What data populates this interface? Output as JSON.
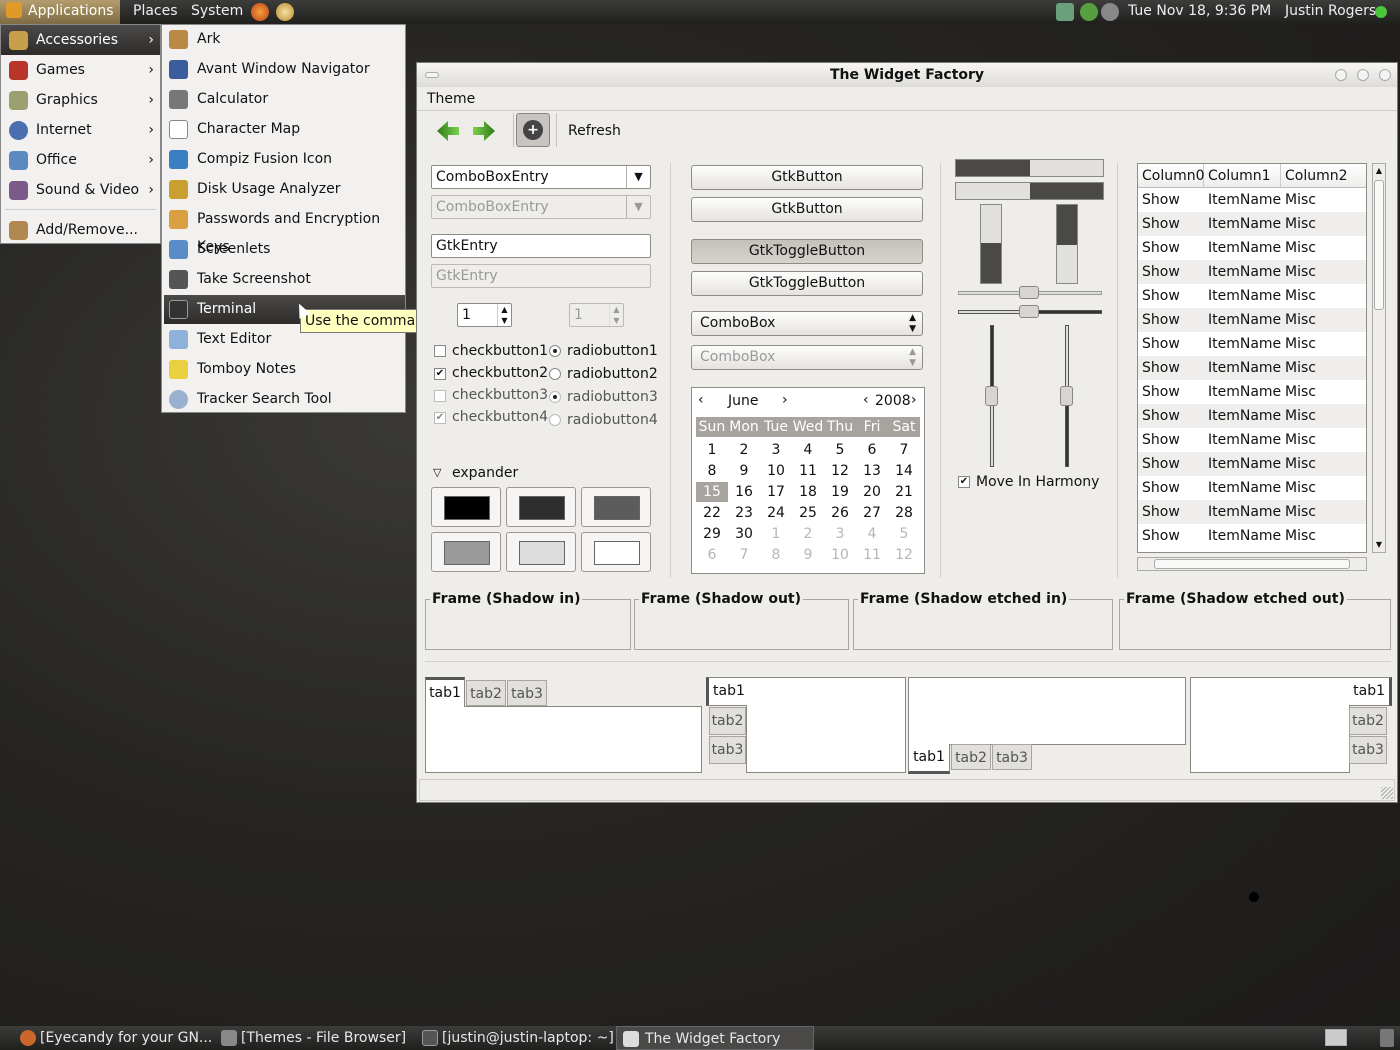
{
  "top_panel": {
    "applications": "Applications",
    "places": "Places",
    "system": "System",
    "clock": "Tue Nov 18,  9:36 PM",
    "user": "Justin Rogers"
  },
  "main_menu": {
    "items": [
      {
        "label": "Accessories",
        "icon": "accessories-icon"
      },
      {
        "label": "Games",
        "icon": "games-icon"
      },
      {
        "label": "Graphics",
        "icon": "graphics-icon"
      },
      {
        "label": "Internet",
        "icon": "internet-icon"
      },
      {
        "label": "Office",
        "icon": "office-icon"
      },
      {
        "label": "Sound & Video",
        "icon": "sound-video-icon"
      },
      {
        "label": "Add/Remove...",
        "icon": "add-remove-icon"
      }
    ]
  },
  "sub_menu": {
    "items": [
      {
        "label": "Ark"
      },
      {
        "label": "Avant Window Navigator"
      },
      {
        "label": "Calculator"
      },
      {
        "label": "Character Map"
      },
      {
        "label": "Compiz Fusion Icon"
      },
      {
        "label": "Disk Usage Analyzer"
      },
      {
        "label": "Passwords and Encryption Keys"
      },
      {
        "label": "Screenlets"
      },
      {
        "label": "Take Screenshot"
      },
      {
        "label": "Terminal"
      },
      {
        "label": "Text Editor"
      },
      {
        "label": "Tomboy Notes"
      },
      {
        "label": "Tracker Search Tool"
      }
    ],
    "tooltip": "Use the command line"
  },
  "window": {
    "title": "The Widget Factory",
    "menu_theme": "Theme",
    "toolbar_refresh": "Refresh",
    "combo_entry_1": "ComboBoxEntry",
    "combo_entry_2": "ComboBoxEntry",
    "entry_1": "GtkEntry",
    "entry_2": "GtkEntry",
    "spin_1": "1",
    "spin_2": "1",
    "checks": [
      "checkbutton1",
      "checkbutton2",
      "checkbutton3",
      "checkbutton4"
    ],
    "radios": [
      "radiobutton1",
      "radiobutton2",
      "radiobutton3",
      "radiobutton4"
    ],
    "expander": "expander",
    "button_1": "GtkButton",
    "button_2": "GtkButton",
    "toggle_1": "GtkToggleButton",
    "toggle_2": "GtkToggleButton",
    "combo_1": "ComboBox",
    "combo_2": "ComboBox",
    "calendar": {
      "month": "June",
      "year": "2008",
      "weekdays": [
        "Sun",
        "Mon",
        "Tue",
        "Wed",
        "Thu",
        "Fri",
        "Sat"
      ],
      "weeks": [
        [
          "1",
          "2",
          "3",
          "4",
          "5",
          "6",
          "7"
        ],
        [
          "8",
          "9",
          "10",
          "11",
          "12",
          "13",
          "14"
        ],
        [
          "15",
          "16",
          "17",
          "18",
          "19",
          "20",
          "21"
        ],
        [
          "22",
          "23",
          "24",
          "25",
          "26",
          "27",
          "28"
        ],
        [
          "29",
          "30",
          "1",
          "2",
          "3",
          "4",
          "5"
        ],
        [
          "6",
          "7",
          "8",
          "9",
          "10",
          "11",
          "12"
        ]
      ],
      "selected": "15"
    },
    "harmony": "Move In Harmony",
    "progress_1": 0.5,
    "progress_2": 0.5,
    "tree": {
      "columns": [
        "Column0",
        "Column1",
        "Column2"
      ],
      "rows": [
        [
          "Show",
          "ItemName",
          "Misc"
        ],
        [
          "Show",
          "ItemName",
          "Misc"
        ],
        [
          "Show",
          "ItemName",
          "Misc"
        ],
        [
          "Show",
          "ItemName",
          "Misc"
        ],
        [
          "Show",
          "ItemName",
          "Misc"
        ],
        [
          "Show",
          "ItemName",
          "Misc"
        ],
        [
          "Show",
          "ItemName",
          "Misc"
        ],
        [
          "Show",
          "ItemName",
          "Misc"
        ],
        [
          "Show",
          "ItemName",
          "Misc"
        ],
        [
          "Show",
          "ItemName",
          "Misc"
        ],
        [
          "Show",
          "ItemName",
          "Misc"
        ],
        [
          "Show",
          "ItemName",
          "Misc"
        ],
        [
          "Show",
          "ItemName",
          "Misc"
        ],
        [
          "Show",
          "ItemName",
          "Misc"
        ],
        [
          "Show",
          "ItemName",
          "Misc"
        ]
      ]
    },
    "frames": [
      "Frame (Shadow in)",
      "Frame (Shadow out)",
      "Frame (Shadow etched in)",
      "Frame (Shadow etched out)"
    ],
    "tabs": [
      "tab1",
      "tab2",
      "tab3"
    ]
  },
  "bottom_panel": {
    "tasks": [
      "[Eyecandy for your GN...",
      "[Themes - File Browser]",
      "[justin@justin-laptop: ~]",
      "The Widget Factory"
    ]
  },
  "colors": {
    "accent": "#2d2c2b",
    "tooltip": "#ffffbf",
    "panel": "#2a2a29"
  }
}
